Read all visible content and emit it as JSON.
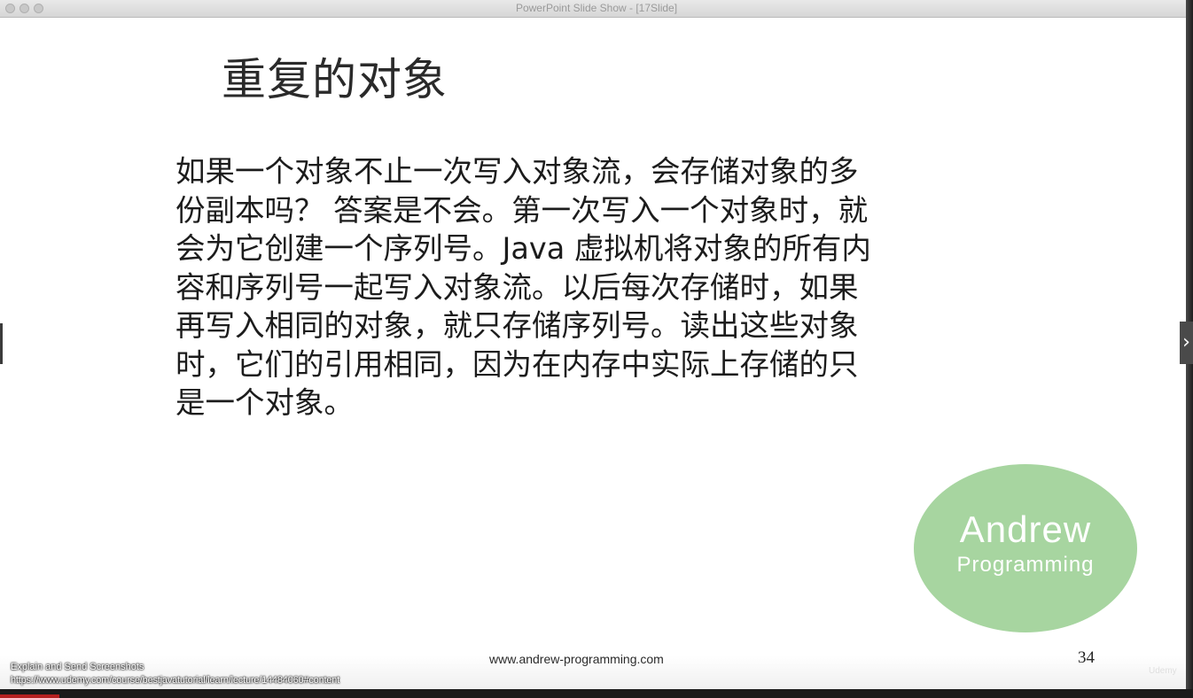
{
  "window": {
    "title": "PowerPoint Slide Show - [17Slide]"
  },
  "slide": {
    "title": "重复的对象",
    "body_lines": [
      "如果一个对象不止一次写入对象流，会存储对象的多",
      "份副本吗？ 答案是不会。第一次写入一个对象时，就",
      "会为它创建一个序列号。Java 虚拟机将对象的所有内",
      "容和序列号一起写入对象流。以后每次存储时，如果",
      "再写入相同的对象，就只存储序列号。读出这些对象",
      "时，它们的引用相同，因为在内存中实际上存储的只",
      "是一个对象。"
    ],
    "logo": {
      "line1": "Andrew",
      "line2": "Programming",
      "color": "#a7d5a0"
    },
    "footer_url": "www.andrew-programming.com",
    "page_number": "34"
  },
  "navigation": {
    "prev_icon": "chevron-left-icon",
    "next_icon": "chevron-right-icon",
    "next_glyph": "›"
  },
  "overlay": {
    "hint": "Explain and Send Screenshots",
    "url": "https://www.udemy.com/course/bestjavatutorial/learn/lecture/14484060#content",
    "watermark": "Udemy"
  },
  "playback": {
    "progress_fraction": 0.05,
    "progress_color": "#b52020"
  }
}
